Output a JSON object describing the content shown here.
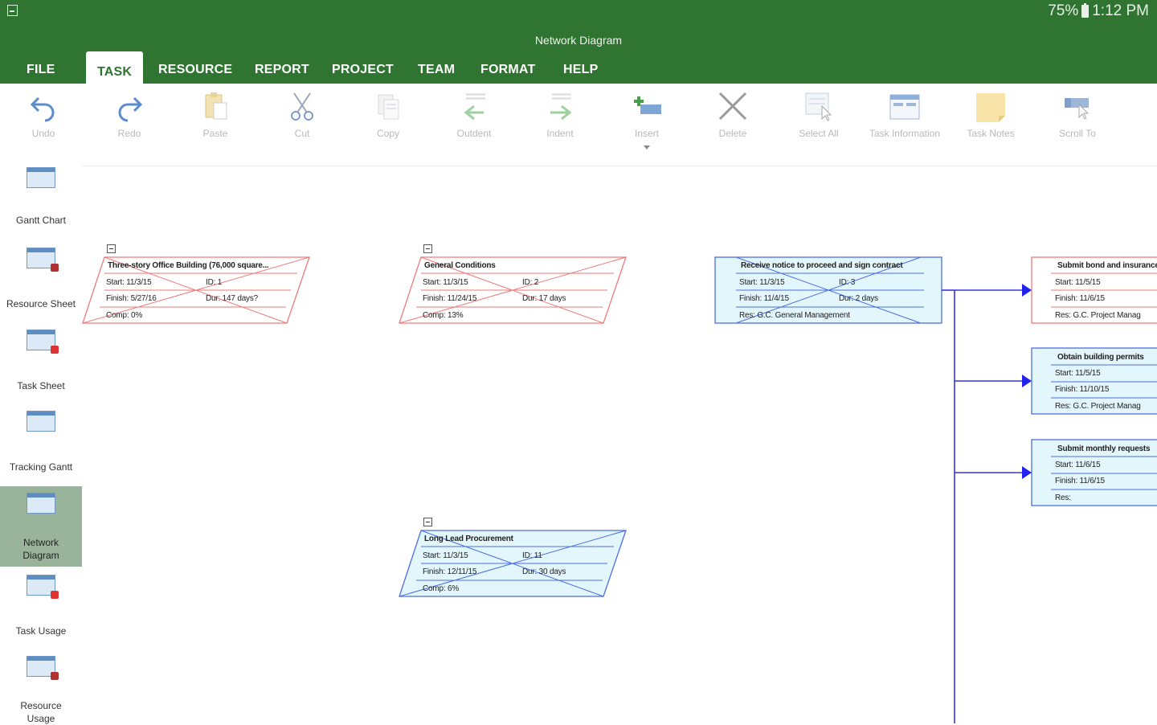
{
  "status_bar": {
    "battery": "75%",
    "time": "1:12 PM"
  },
  "app": {
    "title": "Network Diagram"
  },
  "tabs": [
    "FILE",
    "TASK",
    "RESOURCE",
    "REPORT",
    "PROJECT",
    "TEAM",
    "FORMAT",
    "HELP"
  ],
  "active_tab": "TASK",
  "toolbar": {
    "undo": "Undo",
    "redo": "Redo",
    "paste": "Paste",
    "cut": "Cut",
    "copy": "Copy",
    "outdent": "Outdent",
    "indent": "Indent",
    "insert": "Insert",
    "delete": "Delete",
    "select_all": "Select All",
    "task_information": "Task Information",
    "task_notes": "Task Notes",
    "scroll_to": "Scroll To"
  },
  "views": [
    {
      "label": "Gantt Chart"
    },
    {
      "label": "Resource Sheet"
    },
    {
      "label": "Task Sheet"
    },
    {
      "label": "Tracking Gantt"
    },
    {
      "label": "Network Diagram",
      "active": true
    },
    {
      "label": "Task Usage"
    },
    {
      "label": "Resource Usage"
    }
  ],
  "nodes": {
    "n1": {
      "title": "Three-story Office Building (76,000 square...",
      "start": "Start:  11/3/15",
      "id": "ID:  1",
      "finish": "Finish:  5/27/16",
      "dur": "Dur: 147 days?",
      "comp": "Comp:  0%"
    },
    "n2": {
      "title": "General Conditions",
      "start": "Start:  11/3/15",
      "id": "ID:  2",
      "finish": "Finish:  11/24/15",
      "dur": "Dur: 17 days",
      "comp": "Comp:  13%"
    },
    "n3": {
      "title": "Receive notice to proceed and sign contract",
      "start": "Start:  11/3/15",
      "id": "ID:  3",
      "finish": "Finish:  11/4/15",
      "dur": "Dur: 2 days",
      "res": "Res:  G.C. General Management"
    },
    "n4": {
      "title": "Submit bond and insurance",
      "start": "Start:  11/5/15",
      "finish": "Finish:  11/6/15",
      "res": "Res:  G.C. Project Manag"
    },
    "n5": {
      "title": "Obtain building permits",
      "start": "Start:  11/5/15",
      "finish": "Finish:  11/10/15",
      "res": "Res:  G.C. Project Manag"
    },
    "n6": {
      "title": "Submit monthly requests",
      "start": "Start:  11/6/15",
      "finish": "Finish:  11/6/15",
      "res": "Res:"
    },
    "n7": {
      "title": "Long Lead Procurement",
      "start": "Start:  11/3/15",
      "id": "ID:  11",
      "finish": "Finish:  12/11/15",
      "dur": "Dur: 30 days",
      "comp": "Comp:  6%"
    }
  }
}
